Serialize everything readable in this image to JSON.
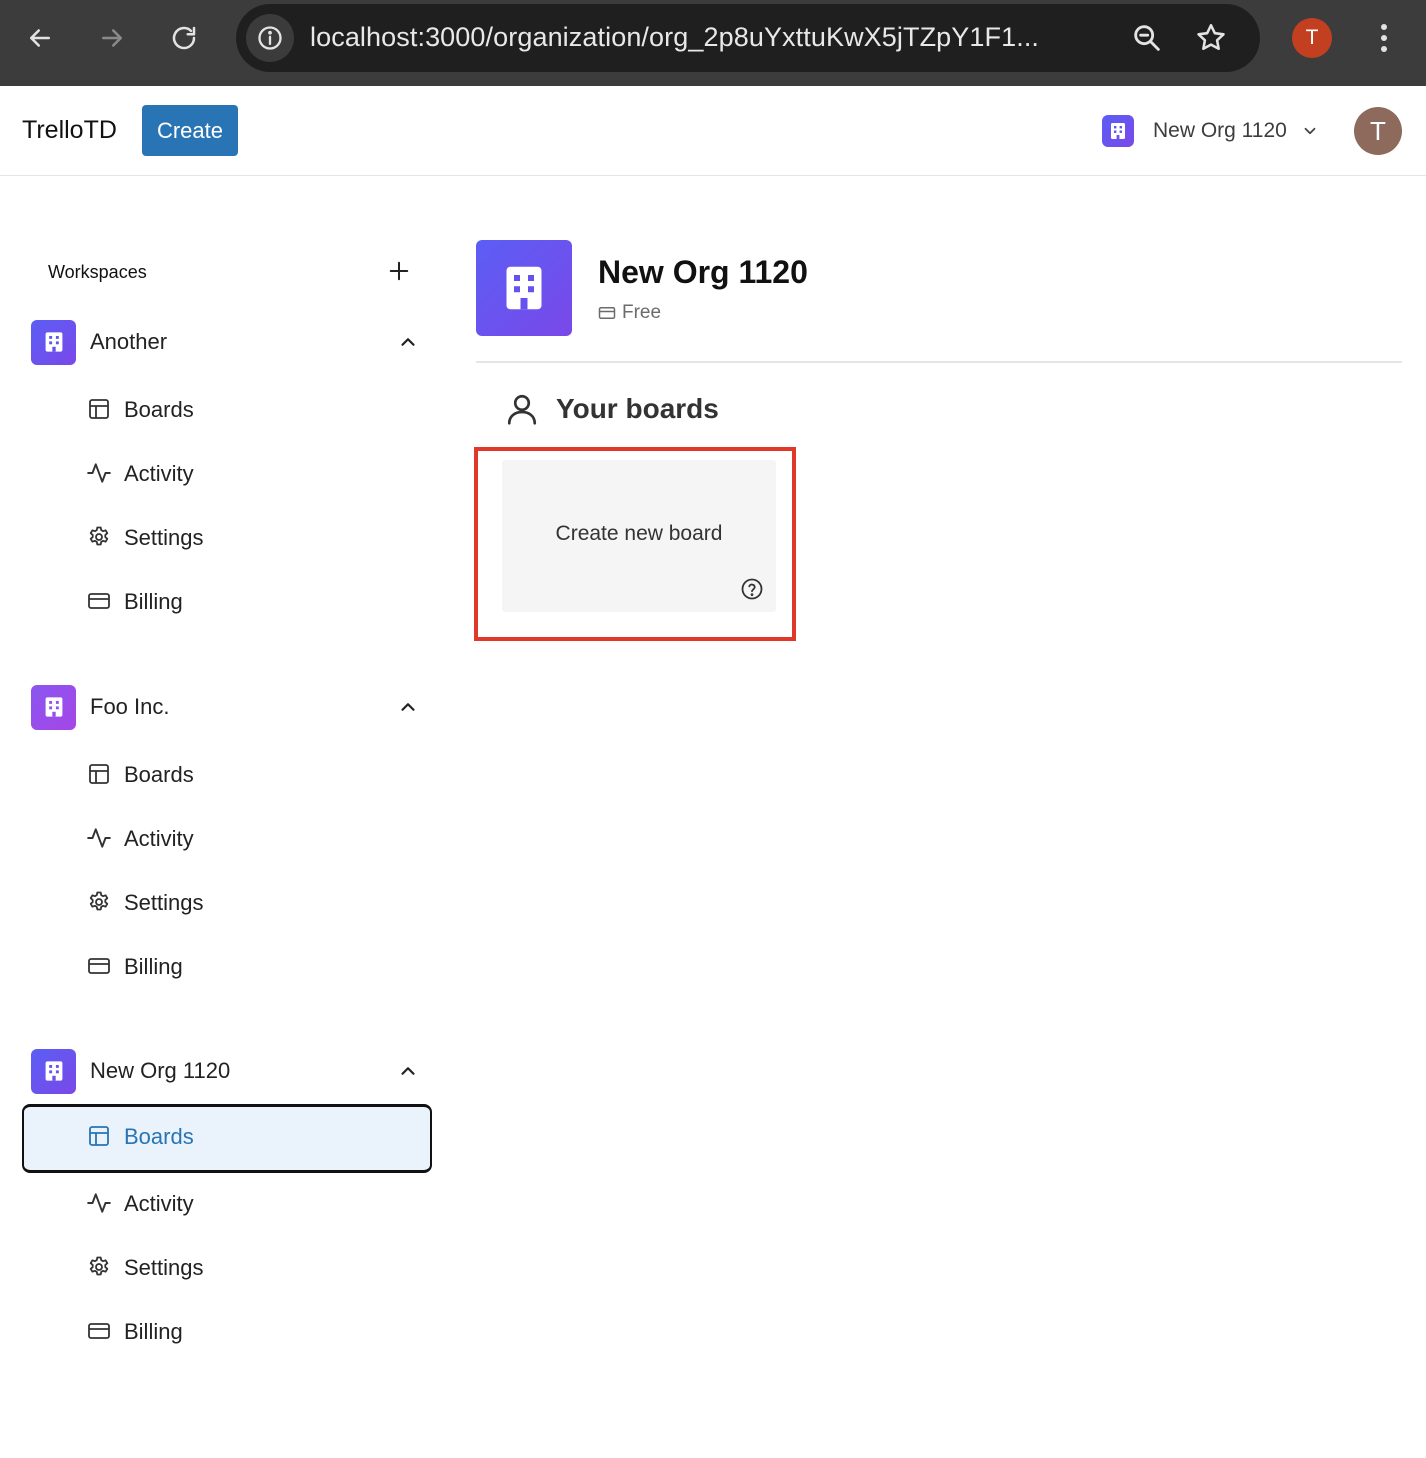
{
  "browser": {
    "url": "localhost:3000/organization/org_2p8uYxttuKwX5jTZpY1F1...",
    "profile_initial": "T"
  },
  "header": {
    "brand": "TrelloTD",
    "create_label": "Create",
    "current_org": "New Org 1120",
    "user_initial": "T"
  },
  "sidebar": {
    "title": "Workspaces",
    "orgs": [
      {
        "name": "Another",
        "items": [
          "Boards",
          "Activity",
          "Settings",
          "Billing"
        ]
      },
      {
        "name": "Foo Inc.",
        "items": [
          "Boards",
          "Activity",
          "Settings",
          "Billing"
        ]
      },
      {
        "name": "New Org 1120",
        "items": [
          "Boards",
          "Activity",
          "Settings",
          "Billing"
        ],
        "active_item": "Boards"
      }
    ]
  },
  "main": {
    "org_title": "New Org 1120",
    "plan": "Free",
    "section_title": "Your boards",
    "create_board_label": "Create new board"
  },
  "colors": {
    "accent": "#2874b4",
    "org_icon_gradient_start": "#5b5ef5",
    "org_icon_gradient_end": "#7a48e8",
    "highlight": "#e0392a",
    "active_bg": "#eaf3fc"
  }
}
